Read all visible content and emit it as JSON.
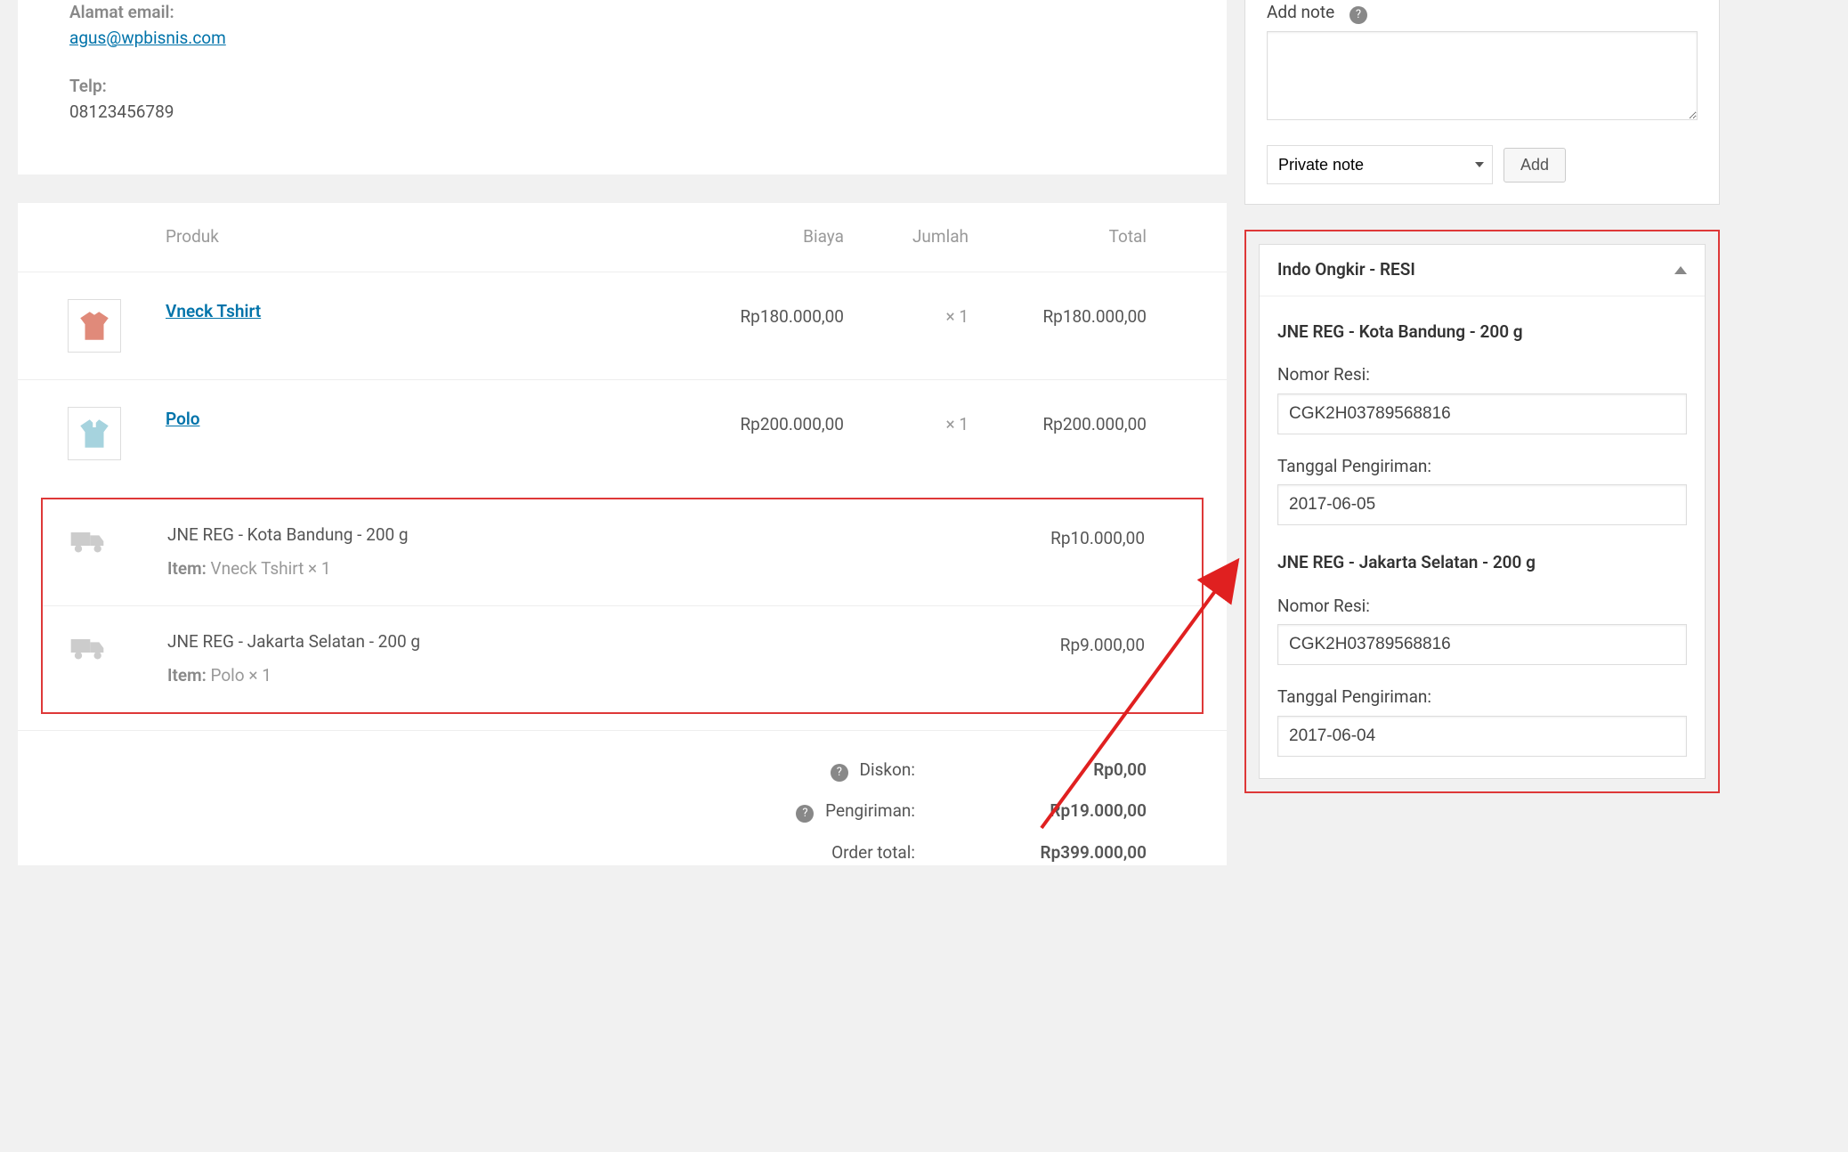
{
  "contact": {
    "email_label": "Alamat email:",
    "email_value": "agus@wpbisnis.com",
    "phone_label": "Telp:",
    "phone_value": "08123456789"
  },
  "order_table": {
    "headers": {
      "produk": "Produk",
      "biaya": "Biaya",
      "jumlah": "Jumlah",
      "total": "Total"
    },
    "items": [
      {
        "name": "Vneck Tshirt",
        "cost": "Rp180.000,00",
        "qty": "× 1",
        "total": "Rp180.000,00",
        "thumb_color": "#e08a7a"
      },
      {
        "name": "Polo",
        "cost": "Rp200.000,00",
        "qty": "× 1",
        "total": "Rp200.000,00",
        "thumb_color": "#a6d3de"
      }
    ]
  },
  "shipping": [
    {
      "title": "JNE REG - Kota Bandung - 200 g",
      "item_label": "Item:",
      "item_value": "Vneck Tshirt × 1",
      "cost": "Rp10.000,00"
    },
    {
      "title": "JNE REG - Jakarta Selatan - 200 g",
      "item_label": "Item:",
      "item_value": "Polo × 1",
      "cost": "Rp9.000,00"
    }
  ],
  "totals": {
    "diskon_label": "Diskon:",
    "diskon_value": "Rp0,00",
    "pengiriman_label": "Pengiriman:",
    "pengiriman_value": "Rp19.000,00",
    "order_total_label": "Order total:",
    "order_total_value": "Rp399.000,00"
  },
  "add_note": {
    "label": "Add note",
    "select_value": "Private note",
    "add_button": "Add"
  },
  "resi_panel": {
    "title": "Indo Ongkir - RESI",
    "sections": [
      {
        "title": "JNE REG - Kota Bandung - 200 g",
        "resi_label": "Nomor Resi:",
        "resi_value": "CGK2H03789568816",
        "date_label": "Tanggal Pengiriman:",
        "date_value": "2017-06-05"
      },
      {
        "title": "JNE REG - Jakarta Selatan - 200 g",
        "resi_label": "Nomor Resi:",
        "resi_value": "CGK2H03789568816",
        "date_label": "Tanggal Pengiriman:",
        "date_value": "2017-06-04"
      }
    ]
  }
}
